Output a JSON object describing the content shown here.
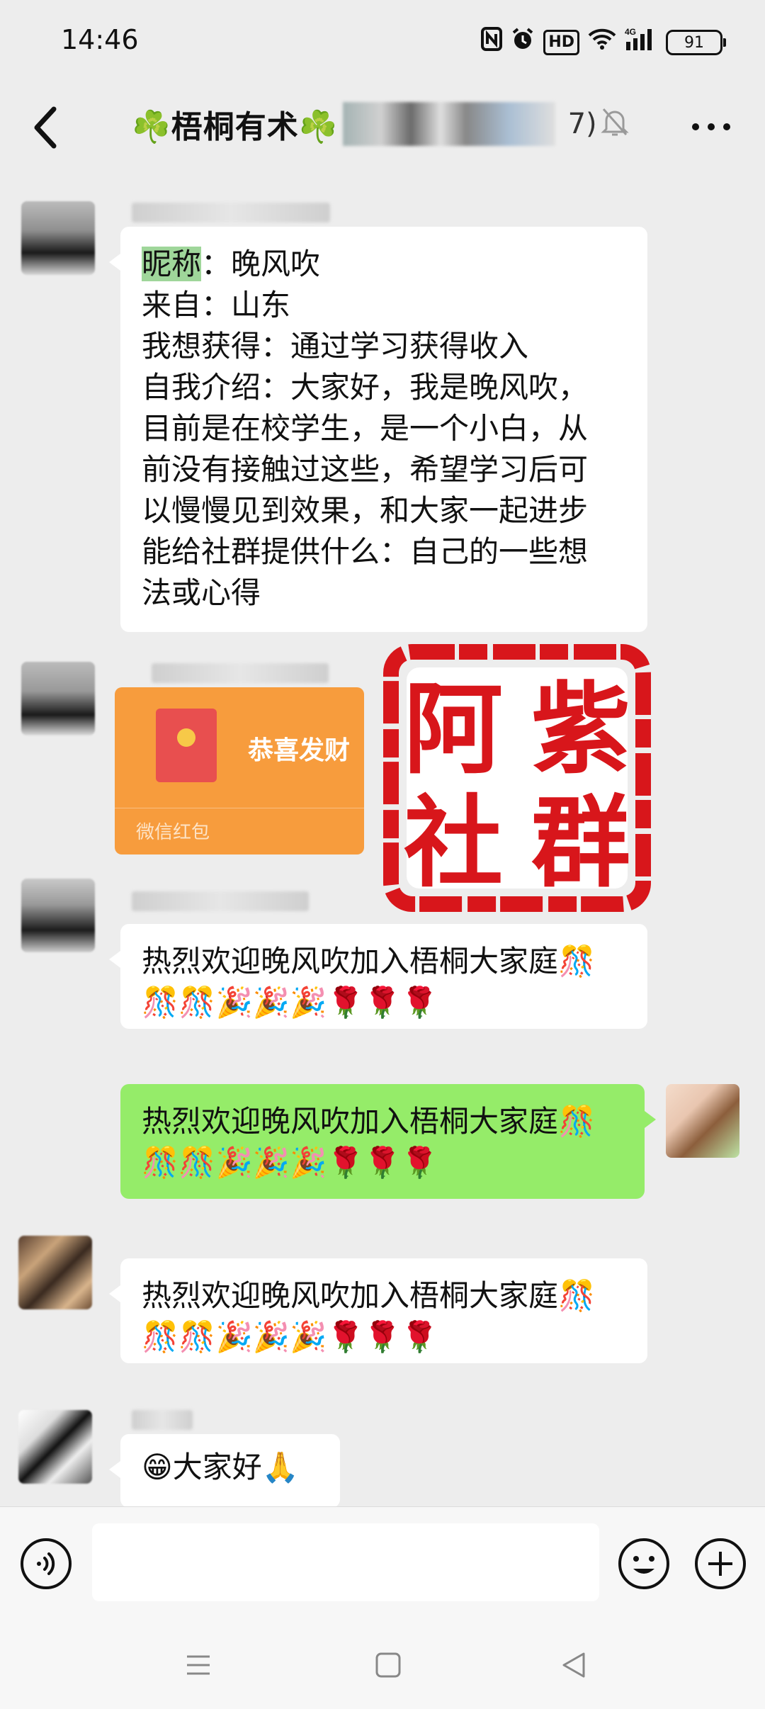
{
  "status": {
    "time": "14:46",
    "battery": "91",
    "network": "4G",
    "hd": "HD"
  },
  "header": {
    "title": "☘️梧桐有术☘️",
    "member_count": "7)"
  },
  "messages": {
    "intro": {
      "lines": [
        {
          "hl": "昵称",
          "rest": "：晚风吹"
        },
        {
          "text": "来自：山东"
        },
        {
          "text": "我想获得：通过学习获得收入"
        },
        {
          "text": "自我介绍：大家好，我是晚风吹，"
        },
        {
          "text": "目前是在校学生，是一个小白，从"
        },
        {
          "text": "前没有接触过这些，希望学习后可"
        },
        {
          "text": "以慢慢见到效果，和大家一起进步"
        },
        {
          "text": "能给社群提供什么：自己的一些想"
        },
        {
          "text": "法或心得"
        }
      ]
    },
    "red_packet": {
      "title": "恭喜发财",
      "label": "微信红包"
    },
    "welcome1": {
      "line1": "热烈欢迎晚风吹加入梧桐大家庭🎊",
      "line2": "🎊🎊🎉🎉🎉🌹🌹🌹"
    },
    "welcome_self": {
      "line1": "热烈欢迎晚风吹加入梧桐大家庭🎊",
      "line2": "🎊🎊🎉🎉🎉🌹🌹🌹"
    },
    "welcome3": {
      "line1": "热烈欢迎晚风吹加入梧桐大家庭🎊",
      "line2": "🎊🎊🎉🎉🎉🌹🌹🌹"
    },
    "greeting": {
      "text": "😁大家好🙏"
    }
  },
  "watermark": {
    "chars": [
      "阿",
      "紫",
      "社",
      "群"
    ],
    "color": "#d8161b"
  },
  "colors": {
    "background": "#ededed",
    "self_bubble": "#95ec69",
    "red_packet": "#f79c3d"
  }
}
